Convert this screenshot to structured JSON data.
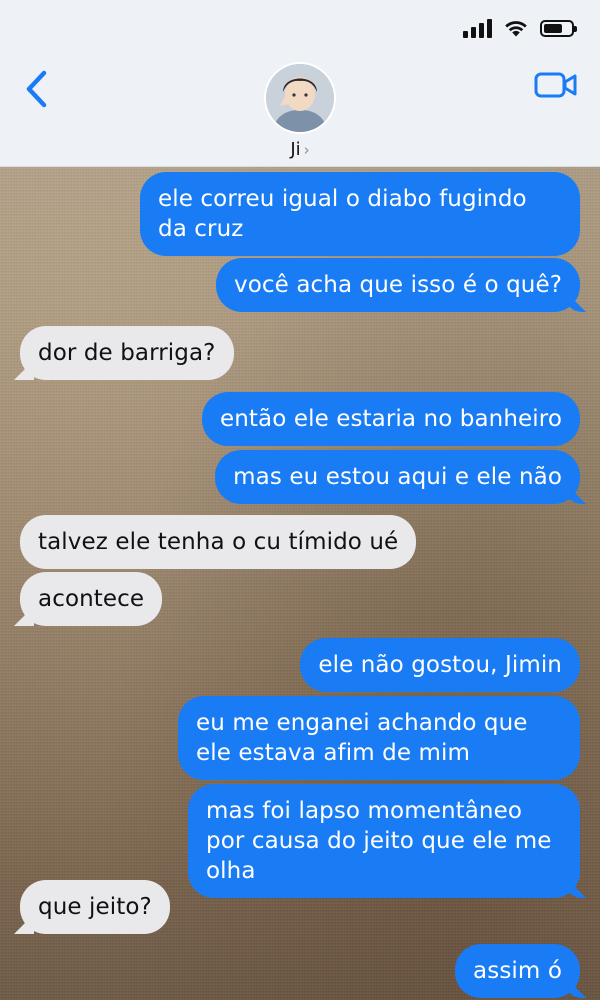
{
  "header": {
    "contact_name": "Ji",
    "chevron": "›",
    "icons": {
      "back": "chevron-left-icon",
      "video": "video-camera-icon",
      "signal": "cellular-signal-icon",
      "wifi": "wifi-icon",
      "battery": "battery-icon"
    },
    "accent_color": "#1a7cf5"
  },
  "status": {
    "battery_level": 0.7
  },
  "messages": [
    {
      "from": "me",
      "text": "ele correu igual o diabo fugindo da cruz"
    },
    {
      "from": "me",
      "text": "você acha que isso é o quê?"
    },
    {
      "from": "them",
      "text": "dor de barriga?"
    },
    {
      "from": "me",
      "text": "então ele estaria no banheiro"
    },
    {
      "from": "me",
      "text": "mas eu estou aqui e ele não"
    },
    {
      "from": "them",
      "text": "talvez ele tenha o cu tímido ué"
    },
    {
      "from": "them",
      "text": "acontece"
    },
    {
      "from": "me",
      "text": "ele não gostou, Jimin"
    },
    {
      "from": "me",
      "text": "eu me enganei achando que ele estava afim de mim"
    },
    {
      "from": "me",
      "text": "mas foi lapso momentâneo por causa do jeito que ele me olha"
    },
    {
      "from": "them",
      "text": "que jeito?"
    },
    {
      "from": "me",
      "text": "assim ó"
    }
  ],
  "colors": {
    "sent_bubble": "#1a7cf5",
    "received_bubble": "#e9e9ec"
  }
}
